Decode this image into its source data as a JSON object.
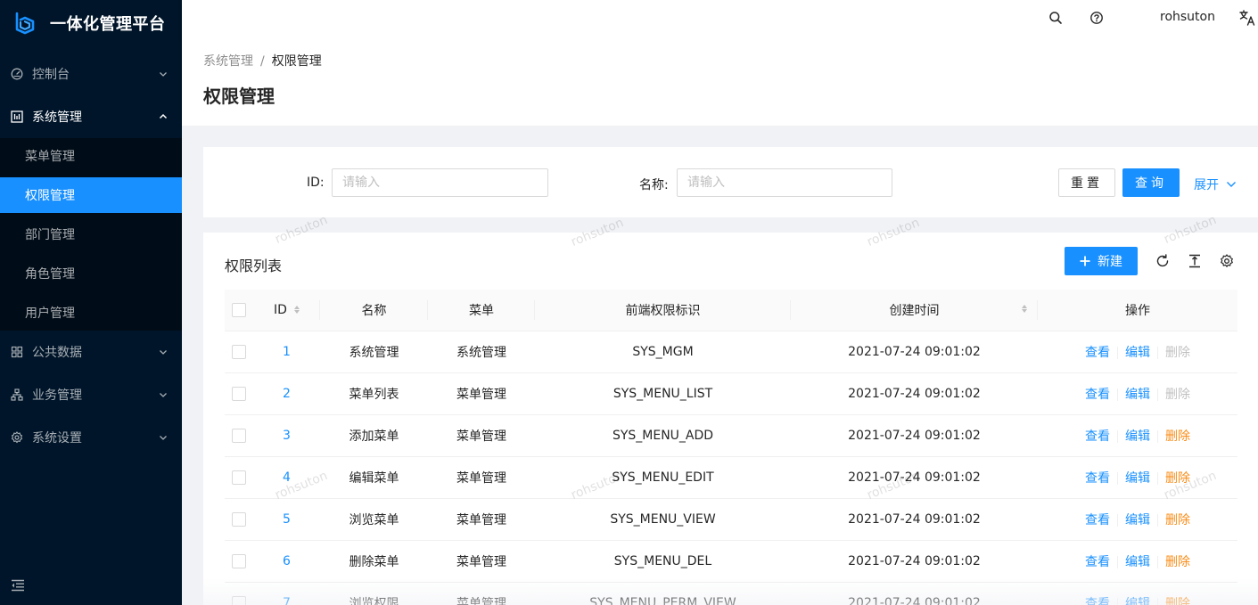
{
  "app": {
    "title": "一体化管理平台"
  },
  "sidebar": {
    "items": [
      {
        "label": "控制台",
        "icon": "dashboard-icon",
        "expanded": false
      },
      {
        "label": "系统管理",
        "icon": "system-icon",
        "expanded": true,
        "children": [
          {
            "label": "菜单管理",
            "active": false
          },
          {
            "label": "权限管理",
            "active": true
          },
          {
            "label": "部门管理",
            "active": false
          },
          {
            "label": "角色管理",
            "active": false
          },
          {
            "label": "用户管理",
            "active": false
          }
        ]
      },
      {
        "label": "公共数据",
        "icon": "appstore-icon",
        "expanded": false
      },
      {
        "label": "业务管理",
        "icon": "cluster-icon",
        "expanded": false
      },
      {
        "label": "系统设置",
        "icon": "setting-icon",
        "expanded": false
      }
    ]
  },
  "header": {
    "username": "rohsuton"
  },
  "breadcrumb": {
    "parent": "系统管理",
    "separator": "/",
    "current": "权限管理"
  },
  "page": {
    "title": "权限管理"
  },
  "search": {
    "id_label": "ID:",
    "id_placeholder": "请输入",
    "name_label": "名称:",
    "name_placeholder": "请输入",
    "reset_label": "重置",
    "query_label": "查询",
    "expand_label": "展开"
  },
  "table": {
    "title": "权限列表",
    "new_label": "新建",
    "columns": [
      "ID",
      "名称",
      "菜单",
      "前端权限标识",
      "创建时间",
      "操作"
    ],
    "actions": {
      "view": "查看",
      "edit": "编辑",
      "delete": "删除"
    },
    "rows": [
      {
        "id": "1",
        "name": "系统管理",
        "menu": "系统管理",
        "code": "SYS_MGM",
        "created": "2021-07-24 09:01:02",
        "delete_disabled": true
      },
      {
        "id": "2",
        "name": "菜单列表",
        "menu": "菜单管理",
        "code": "SYS_MENU_LIST",
        "created": "2021-07-24 09:01:02",
        "delete_disabled": true
      },
      {
        "id": "3",
        "name": "添加菜单",
        "menu": "菜单管理",
        "code": "SYS_MENU_ADD",
        "created": "2021-07-24 09:01:02",
        "delete_disabled": false
      },
      {
        "id": "4",
        "name": "编辑菜单",
        "menu": "菜单管理",
        "code": "SYS_MENU_EDIT",
        "created": "2021-07-24 09:01:02",
        "delete_disabled": false
      },
      {
        "id": "5",
        "name": "浏览菜单",
        "menu": "菜单管理",
        "code": "SYS_MENU_VIEW",
        "created": "2021-07-24 09:01:02",
        "delete_disabled": false
      },
      {
        "id": "6",
        "name": "删除菜单",
        "menu": "菜单管理",
        "code": "SYS_MENU_DEL",
        "created": "2021-07-24 09:01:02",
        "delete_disabled": false
      },
      {
        "id": "7",
        "name": "浏览权限",
        "menu": "菜单管理",
        "code": "SYS_MENU_PERM_VIEW",
        "created": "2021-07-24 09:01:02",
        "delete_disabled": false
      }
    ]
  },
  "watermark": "rohsuton",
  "colors": {
    "sidebar": "#001529",
    "primary": "#1890ff",
    "danger_link": "#fa8c16"
  }
}
